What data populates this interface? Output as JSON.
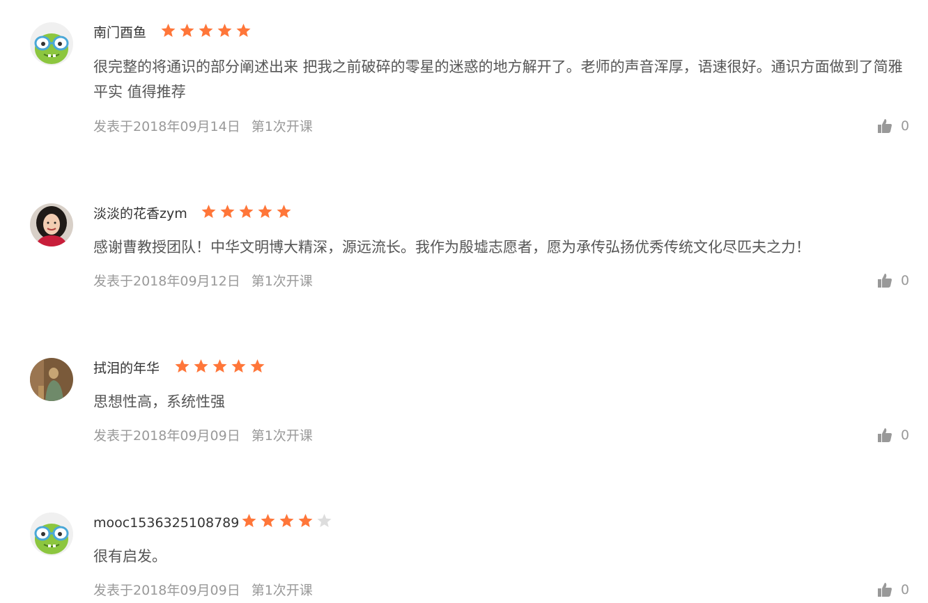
{
  "colors": {
    "star_filled": "#ff7639",
    "star_empty": "#dddddd",
    "name_text": "#333333",
    "content_text": "#555555",
    "meta_text": "#999999"
  },
  "comments": [
    {
      "user": "南门酉鱼",
      "avatar": "green-monster-avatar",
      "rating": 5,
      "content": "很完整的将通识的部分阐述出来 把我之前破碎的零星的迷惑的地方解开了。老师的声音浑厚，语速很好。通识方面做到了简雅平实 值得推荐",
      "date": "发表于2018年09月14日",
      "term": "第1次开课",
      "likes": "0"
    },
    {
      "user": "淡淡的花香zym",
      "avatar": "woman-photo-avatar",
      "rating": 5,
      "content": "感谢曹教授团队！中华文明博大精深，源远流长。我作为殷墟志愿者，愿为承传弘扬优秀传统文化尽匹夫之力！",
      "date": "发表于2018年09月12日",
      "term": "第1次开课",
      "likes": "0"
    },
    {
      "user": "拭泪的年华",
      "avatar": "statue-photo-avatar",
      "rating": 5,
      "content": "思想性高，系统性强",
      "date": "发表于2018年09月09日",
      "term": "第1次开课",
      "likes": "0"
    },
    {
      "user": "mooc1536325108789",
      "avatar": "green-monster-avatar",
      "rating": 4,
      "content": "很有启发。",
      "date": "发表于2018年09月09日",
      "term": "第1次开课",
      "likes": "0"
    }
  ]
}
